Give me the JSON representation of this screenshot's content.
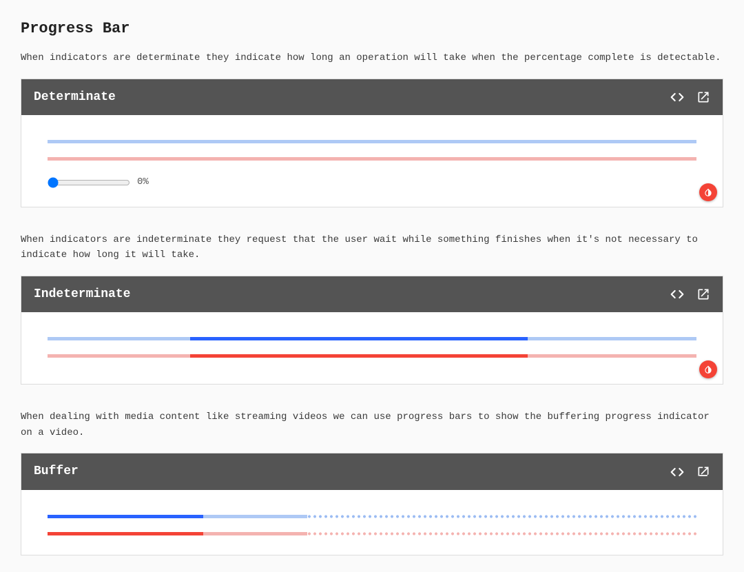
{
  "page": {
    "title": "Progress Bar"
  },
  "sections": {
    "determinate": {
      "desc": "When indicators are determinate they indicate how long an operation will take when the percentage complete is detectable.",
      "title": "Determinate",
      "slider_value": "0%"
    },
    "indeterminate": {
      "desc": "When indicators are indeterminate they request that the user wait while something finishes when it's not necessary to indicate how long it will take.",
      "title": "Indeterminate"
    },
    "buffer": {
      "desc": "When dealing with media content like streaming videos we can use progress bars to show the buffering progress indicator on a video.",
      "title": "Buffer"
    }
  },
  "icons": {
    "code": "code-icon",
    "open_new": "open-in-new-icon",
    "invert": "invert-colors-icon"
  },
  "colors": {
    "primary_blue": "#2962ff",
    "primary_blue_light": "#aec9f5",
    "accent_red": "#f44336",
    "accent_red_light": "#f4b3b0",
    "header_bg": "#545454"
  }
}
